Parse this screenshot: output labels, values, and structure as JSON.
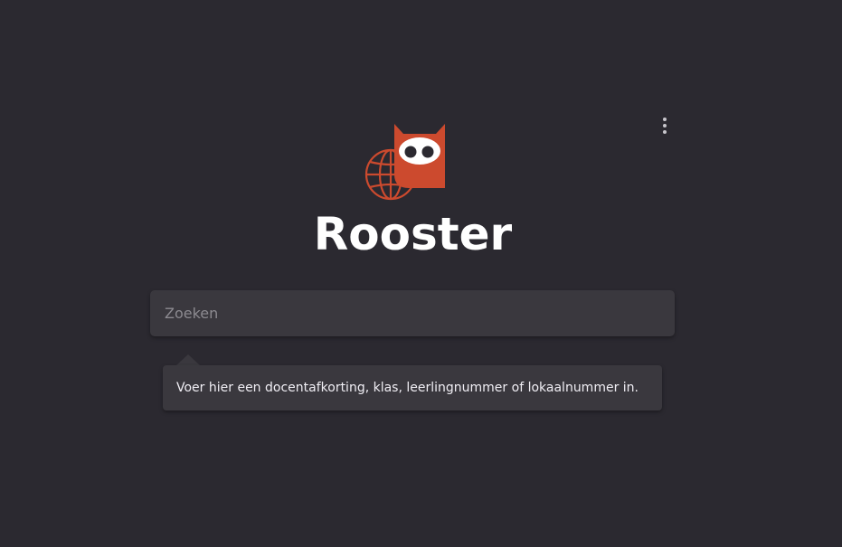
{
  "app": {
    "title": "Rooster"
  },
  "search": {
    "placeholder": "Zoeken",
    "value": ""
  },
  "tooltip": {
    "text": "Voer hier een docentafkorting, klas, leerlingnummer of lokaalnummer in."
  },
  "colors": {
    "background": "#2b2930",
    "accent": "#cc4a2e",
    "surface": "#3a383e",
    "text": "#ffffff"
  },
  "icons": {
    "menu": "more-vertical-icon",
    "logo": "owl-globe-logo"
  }
}
